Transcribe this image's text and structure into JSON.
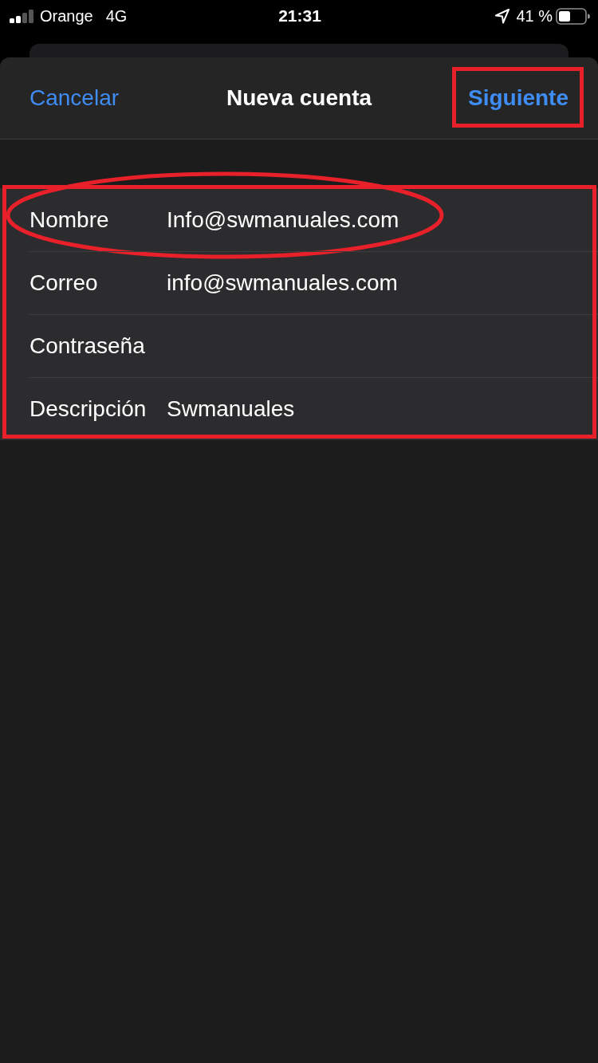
{
  "status_bar": {
    "carrier": "Orange",
    "network": "4G",
    "time": "21:31",
    "battery": "41 %"
  },
  "nav": {
    "cancel": "Cancelar",
    "title": "Nueva cuenta",
    "next": "Siguiente",
    "next_highlighted": true
  },
  "form": {
    "highlighted": true,
    "fields": [
      {
        "label": "Nombre",
        "value": "Info@swmanuales.com",
        "circled": true
      },
      {
        "label": "Correo",
        "value": "info@swmanuales.com",
        "circled": false
      },
      {
        "label": "Contraseña",
        "circled": false
      },
      {
        "label": "Descripción",
        "value": "Swmanuales",
        "circled": false
      }
    ]
  }
}
